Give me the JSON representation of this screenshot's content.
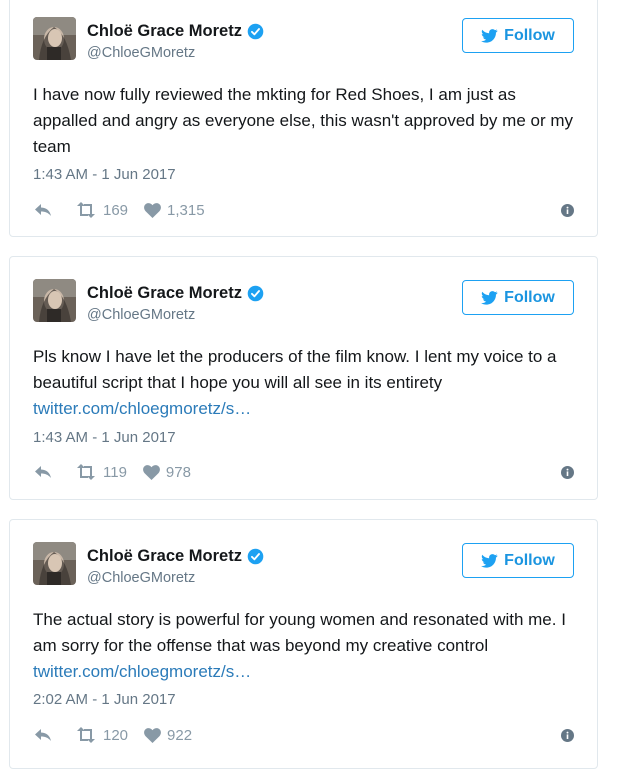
{
  "tweets": [
    {
      "name": "Chloë Grace Moretz",
      "handle": "@ChloeGMoretz",
      "follow_label": "Follow",
      "text": "I have now fully reviewed the mkting for Red Shoes, I am just as appalled and angry as everyone else, this wasn't approved by me or my team",
      "link": "",
      "timestamp": "1:43 AM - 1 Jun 2017",
      "retweets": "169",
      "likes": "1,315"
    },
    {
      "name": "Chloë Grace Moretz",
      "handle": "@ChloeGMoretz",
      "follow_label": "Follow",
      "text": "Pls know I have let the producers of the film know. I lent my voice to a beautiful script that I hope you will all see in its entirety ",
      "link": "twitter.com/chloegmoretz/s…",
      "timestamp": "1:43 AM - 1 Jun 2017",
      "retweets": "119",
      "likes": "978"
    },
    {
      "name": "Chloë Grace Moretz",
      "handle": "@ChloeGMoretz",
      "follow_label": "Follow",
      "text": "The actual story is powerful for young women and resonated with me. I am sorry for the offense that was beyond my creative control ",
      "link": "twitter.com/chloegmoretz/s…",
      "timestamp": "2:02 AM - 1 Jun 2017",
      "retweets": "120",
      "likes": "922"
    }
  ],
  "icons": {
    "reply": "reply-icon",
    "retweet": "retweet-icon",
    "like": "heart-icon",
    "info": "info-icon",
    "verified": "verified-badge-icon",
    "bird": "twitter-bird-icon"
  },
  "colors": {
    "accent": "#1da1f2",
    "link": "#2b7bb9",
    "muted": "#657786",
    "action": "#8899a6",
    "border": "#e1e8ed"
  }
}
